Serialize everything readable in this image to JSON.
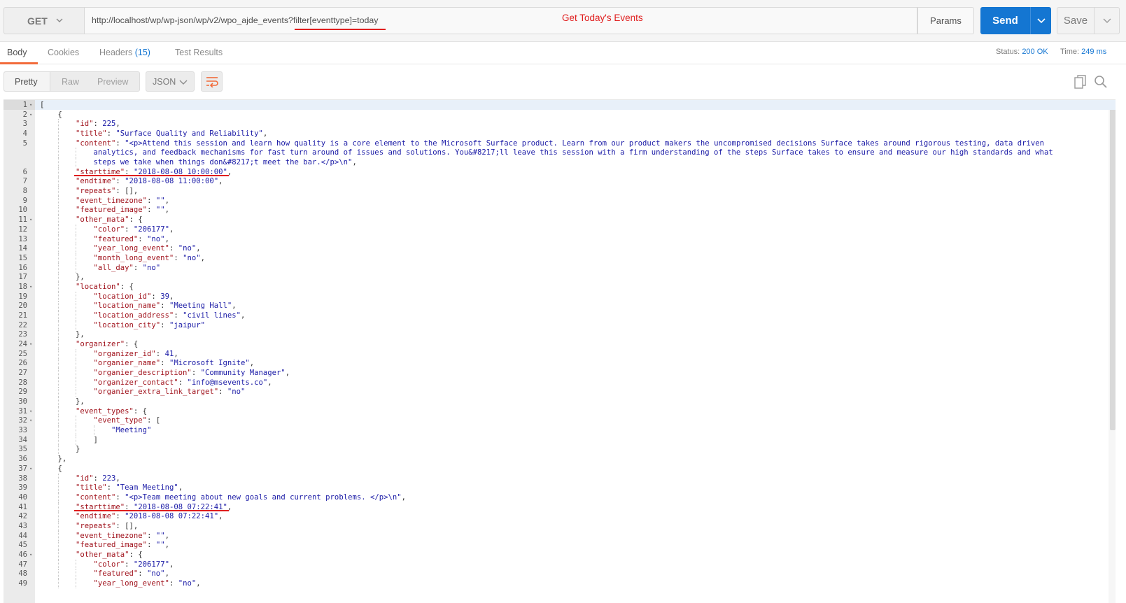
{
  "request": {
    "method": "GET",
    "url": "http://localhost/wp/wp-json/wp/v2/wpo_ajde_events?filter[eventtype]=today",
    "annotation": "Get Today's Events",
    "params_label": "Params",
    "send_label": "Send",
    "save_label": "Save"
  },
  "response_tabs": {
    "body": "Body",
    "cookies": "Cookies",
    "headers": "Headers",
    "headers_count": "(15)",
    "test_results": "Test Results"
  },
  "status": {
    "status_label": "Status:",
    "status_value": "200 OK",
    "time_label": "Time:",
    "time_value": "249 ms"
  },
  "view": {
    "modes": [
      "Pretty",
      "Raw",
      "Preview"
    ],
    "selected_mode": "Pretty",
    "format": "JSON"
  },
  "icons": {
    "method_dropdown": "chevron-down-icon",
    "send_dropdown": "chevron-down-icon",
    "save_dropdown": "chevron-down-icon",
    "format_dropdown": "chevron-down-icon",
    "wrap": "wrap-lines-icon",
    "copy": "copy-icon",
    "search": "search-icon"
  },
  "colors": {
    "send": "#1476d2",
    "active_tab_underline": "#f26b3a",
    "annotation": "#e01e1e",
    "json_key": "#a1141e",
    "json_value": "#1a1aa6"
  },
  "code_lines": [
    {
      "n": "1",
      "indent": 0,
      "fold": true,
      "parts": [
        [
          "p",
          "["
        ]
      ]
    },
    {
      "n": "2",
      "indent": 1,
      "fold": true,
      "parts": [
        [
          "p",
          "{"
        ]
      ]
    },
    {
      "n": "3",
      "indent": 2,
      "parts": [
        [
          "k",
          "\"id\""
        ],
        [
          "p",
          ": "
        ],
        [
          "n",
          "225"
        ],
        [
          "p",
          ","
        ]
      ]
    },
    {
      "n": "4",
      "indent": 2,
      "parts": [
        [
          "k",
          "\"title\""
        ],
        [
          "p",
          ": "
        ],
        [
          "s",
          "\"Surface Quality and Reliability\""
        ],
        [
          "p",
          ","
        ]
      ]
    },
    {
      "n": "5",
      "indent": 2,
      "parts": [
        [
          "k",
          "\"content\""
        ],
        [
          "p",
          ": "
        ],
        [
          "s",
          "\"<p>Attend this session and learn how quality is a core element to the Microsoft Surface product. Learn from our product makers the uncompromised decisions Surface takes around rigorous testing, data driven"
        ]
      ]
    },
    {
      "n": "",
      "indent": 3,
      "parts": [
        [
          "s",
          "analytics, and feedback mechanisms for fast turn around of issues and solutions. You&#8217;ll leave this session with a firm understanding of the steps Surface takes to ensure and measure our high standards and what"
        ]
      ]
    },
    {
      "n": "",
      "indent": 3,
      "parts": [
        [
          "s",
          "steps we take when things don&#8217;t meet the bar.</p>\\n\""
        ],
        [
          "p",
          ","
        ]
      ]
    },
    {
      "n": "6",
      "indent": 2,
      "parts": [
        [
          "k",
          "\"starttime\""
        ],
        [
          "p",
          ": "
        ],
        [
          "s",
          "\"2018-08-08 10:00:00\""
        ],
        [
          "p",
          ","
        ]
      ]
    },
    {
      "n": "7",
      "indent": 2,
      "parts": [
        [
          "k",
          "\"endtime\""
        ],
        [
          "p",
          ": "
        ],
        [
          "s",
          "\"2018-08-08 11:00:00\""
        ],
        [
          "p",
          ","
        ]
      ]
    },
    {
      "n": "8",
      "indent": 2,
      "parts": [
        [
          "k",
          "\"repeats\""
        ],
        [
          "p",
          ": [],"
        ]
      ]
    },
    {
      "n": "9",
      "indent": 2,
      "parts": [
        [
          "k",
          "\"event_timezone\""
        ],
        [
          "p",
          ": "
        ],
        [
          "s",
          "\"\""
        ],
        [
          "p",
          ","
        ]
      ]
    },
    {
      "n": "10",
      "indent": 2,
      "parts": [
        [
          "k",
          "\"featured_image\""
        ],
        [
          "p",
          ": "
        ],
        [
          "s",
          "\"\""
        ],
        [
          "p",
          ","
        ]
      ]
    },
    {
      "n": "11",
      "indent": 2,
      "fold": true,
      "parts": [
        [
          "k",
          "\"other_mata\""
        ],
        [
          "p",
          ": {"
        ]
      ]
    },
    {
      "n": "12",
      "indent": 3,
      "parts": [
        [
          "k",
          "\"color\""
        ],
        [
          "p",
          ": "
        ],
        [
          "s",
          "\"206177\""
        ],
        [
          "p",
          ","
        ]
      ]
    },
    {
      "n": "13",
      "indent": 3,
      "parts": [
        [
          "k",
          "\"featured\""
        ],
        [
          "p",
          ": "
        ],
        [
          "s",
          "\"no\""
        ],
        [
          "p",
          ","
        ]
      ]
    },
    {
      "n": "14",
      "indent": 3,
      "parts": [
        [
          "k",
          "\"year_long_event\""
        ],
        [
          "p",
          ": "
        ],
        [
          "s",
          "\"no\""
        ],
        [
          "p",
          ","
        ]
      ]
    },
    {
      "n": "15",
      "indent": 3,
      "parts": [
        [
          "k",
          "\"month_long_event\""
        ],
        [
          "p",
          ": "
        ],
        [
          "s",
          "\"no\""
        ],
        [
          "p",
          ","
        ]
      ]
    },
    {
      "n": "16",
      "indent": 3,
      "parts": [
        [
          "k",
          "\"all_day\""
        ],
        [
          "p",
          ": "
        ],
        [
          "s",
          "\"no\""
        ]
      ]
    },
    {
      "n": "17",
      "indent": 2,
      "parts": [
        [
          "p",
          "},"
        ]
      ]
    },
    {
      "n": "18",
      "indent": 2,
      "fold": true,
      "parts": [
        [
          "k",
          "\"location\""
        ],
        [
          "p",
          ": {"
        ]
      ]
    },
    {
      "n": "19",
      "indent": 3,
      "parts": [
        [
          "k",
          "\"location_id\""
        ],
        [
          "p",
          ": "
        ],
        [
          "n",
          "39"
        ],
        [
          "p",
          ","
        ]
      ]
    },
    {
      "n": "20",
      "indent": 3,
      "parts": [
        [
          "k",
          "\"location_name\""
        ],
        [
          "p",
          ": "
        ],
        [
          "s",
          "\"Meeting Hall\""
        ],
        [
          "p",
          ","
        ]
      ]
    },
    {
      "n": "21",
      "indent": 3,
      "parts": [
        [
          "k",
          "\"location_address\""
        ],
        [
          "p",
          ": "
        ],
        [
          "s",
          "\"civil lines\""
        ],
        [
          "p",
          ","
        ]
      ]
    },
    {
      "n": "22",
      "indent": 3,
      "parts": [
        [
          "k",
          "\"location_city\""
        ],
        [
          "p",
          ": "
        ],
        [
          "s",
          "\"jaipur\""
        ]
      ]
    },
    {
      "n": "23",
      "indent": 2,
      "parts": [
        [
          "p",
          "},"
        ]
      ]
    },
    {
      "n": "24",
      "indent": 2,
      "fold": true,
      "parts": [
        [
          "k",
          "\"organizer\""
        ],
        [
          "p",
          ": {"
        ]
      ]
    },
    {
      "n": "25",
      "indent": 3,
      "parts": [
        [
          "k",
          "\"organizer_id\""
        ],
        [
          "p",
          ": "
        ],
        [
          "n",
          "41"
        ],
        [
          "p",
          ","
        ]
      ]
    },
    {
      "n": "26",
      "indent": 3,
      "parts": [
        [
          "k",
          "\"organier_name\""
        ],
        [
          "p",
          ": "
        ],
        [
          "s",
          "\"Microsoft Ignite\""
        ],
        [
          "p",
          ","
        ]
      ]
    },
    {
      "n": "27",
      "indent": 3,
      "parts": [
        [
          "k",
          "\"organier_description\""
        ],
        [
          "p",
          ": "
        ],
        [
          "s",
          "\"Community Manager\""
        ],
        [
          "p",
          ","
        ]
      ]
    },
    {
      "n": "28",
      "indent": 3,
      "parts": [
        [
          "k",
          "\"organizer_contact\""
        ],
        [
          "p",
          ": "
        ],
        [
          "s",
          "\"info@msevents.co\""
        ],
        [
          "p",
          ","
        ]
      ]
    },
    {
      "n": "29",
      "indent": 3,
      "parts": [
        [
          "k",
          "\"organier_extra_link_target\""
        ],
        [
          "p",
          ": "
        ],
        [
          "s",
          "\"no\""
        ]
      ]
    },
    {
      "n": "30",
      "indent": 2,
      "parts": [
        [
          "p",
          "},"
        ]
      ]
    },
    {
      "n": "31",
      "indent": 2,
      "fold": true,
      "parts": [
        [
          "k",
          "\"event_types\""
        ],
        [
          "p",
          ": {"
        ]
      ]
    },
    {
      "n": "32",
      "indent": 3,
      "fold": true,
      "parts": [
        [
          "k",
          "\"event_type\""
        ],
        [
          "p",
          ": ["
        ]
      ]
    },
    {
      "n": "33",
      "indent": 4,
      "parts": [
        [
          "s",
          "\"Meeting\""
        ]
      ]
    },
    {
      "n": "34",
      "indent": 3,
      "parts": [
        [
          "p",
          "]"
        ]
      ]
    },
    {
      "n": "35",
      "indent": 2,
      "parts": [
        [
          "p",
          "}"
        ]
      ]
    },
    {
      "n": "36",
      "indent": 1,
      "parts": [
        [
          "p",
          "},"
        ]
      ]
    },
    {
      "n": "37",
      "indent": 1,
      "fold": true,
      "parts": [
        [
          "p",
          "{"
        ]
      ]
    },
    {
      "n": "38",
      "indent": 2,
      "parts": [
        [
          "k",
          "\"id\""
        ],
        [
          "p",
          ": "
        ],
        [
          "n",
          "223"
        ],
        [
          "p",
          ","
        ]
      ]
    },
    {
      "n": "39",
      "indent": 2,
      "parts": [
        [
          "k",
          "\"title\""
        ],
        [
          "p",
          ": "
        ],
        [
          "s",
          "\"Team Meeting\""
        ],
        [
          "p",
          ","
        ]
      ]
    },
    {
      "n": "40",
      "indent": 2,
      "parts": [
        [
          "k",
          "\"content\""
        ],
        [
          "p",
          ": "
        ],
        [
          "s",
          "\"<p>Team meeting about new goals and current problems. </p>\\n\""
        ],
        [
          "p",
          ","
        ]
      ]
    },
    {
      "n": "41",
      "indent": 2,
      "parts": [
        [
          "k",
          "\"starttime\""
        ],
        [
          "p",
          ": "
        ],
        [
          "s",
          "\"2018-08-08 07:22:41\""
        ],
        [
          "p",
          ","
        ]
      ]
    },
    {
      "n": "42",
      "indent": 2,
      "parts": [
        [
          "k",
          "\"endtime\""
        ],
        [
          "p",
          ": "
        ],
        [
          "s",
          "\"2018-08-08 07:22:41\""
        ],
        [
          "p",
          ","
        ]
      ]
    },
    {
      "n": "43",
      "indent": 2,
      "parts": [
        [
          "k",
          "\"repeats\""
        ],
        [
          "p",
          ": [],"
        ]
      ]
    },
    {
      "n": "44",
      "indent": 2,
      "parts": [
        [
          "k",
          "\"event_timezone\""
        ],
        [
          "p",
          ": "
        ],
        [
          "s",
          "\"\""
        ],
        [
          "p",
          ","
        ]
      ]
    },
    {
      "n": "45",
      "indent": 2,
      "parts": [
        [
          "k",
          "\"featured_image\""
        ],
        [
          "p",
          ": "
        ],
        [
          "s",
          "\"\""
        ],
        [
          "p",
          ","
        ]
      ]
    },
    {
      "n": "46",
      "indent": 2,
      "fold": true,
      "parts": [
        [
          "k",
          "\"other_mata\""
        ],
        [
          "p",
          ": {"
        ]
      ]
    },
    {
      "n": "47",
      "indent": 3,
      "parts": [
        [
          "k",
          "\"color\""
        ],
        [
          "p",
          ": "
        ],
        [
          "s",
          "\"206177\""
        ],
        [
          "p",
          ","
        ]
      ]
    },
    {
      "n": "48",
      "indent": 3,
      "parts": [
        [
          "k",
          "\"featured\""
        ],
        [
          "p",
          ": "
        ],
        [
          "s",
          "\"no\""
        ],
        [
          "p",
          ","
        ]
      ]
    },
    {
      "n": "49",
      "indent": 3,
      "parts": [
        [
          "k",
          "\"year_long_event\""
        ],
        [
          "p",
          ": "
        ],
        [
          "s",
          "\"no\""
        ],
        [
          "p",
          ","
        ]
      ]
    }
  ]
}
